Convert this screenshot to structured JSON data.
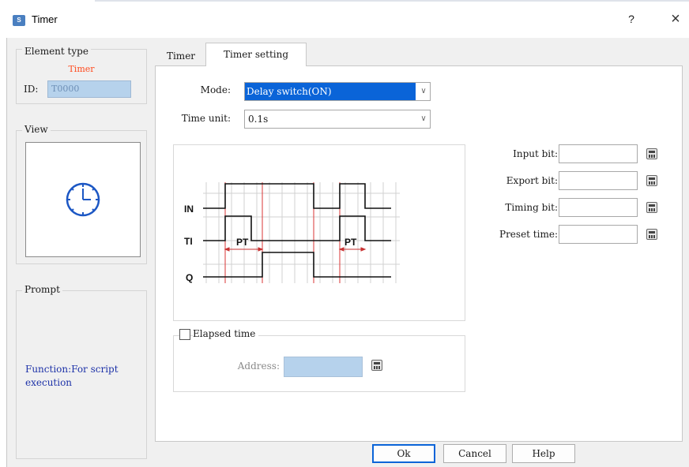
{
  "window": {
    "title": "Timer",
    "icon_text": "S",
    "help_symbol": "?",
    "close_symbol": "×"
  },
  "element_type": {
    "title": "Element type",
    "value": "Timer",
    "id_label": "ID:",
    "id_value": "T0000"
  },
  "view": {
    "title": "View",
    "icon": "clock-icon"
  },
  "prompt": {
    "title": "Prompt",
    "text": "Function:For script execution"
  },
  "tabs": [
    {
      "label": "Timer",
      "active": false
    },
    {
      "label": "Timer setting",
      "active": true
    }
  ],
  "form": {
    "mode_label": "Mode:",
    "mode_value": "Delay switch(ON)",
    "unit_label": "Time unit:",
    "unit_value": "0.1s"
  },
  "diagram": {
    "signals": [
      "IN",
      "TI",
      "Q"
    ],
    "pt_label": "PT"
  },
  "elapsed": {
    "label": "Elapsed time",
    "checked": false,
    "address_label": "Address:",
    "address_value": ""
  },
  "right_fields": [
    {
      "label": "Input bit:",
      "value": ""
    },
    {
      "label": "Export bit:",
      "value": ""
    },
    {
      "label": "Timing bit:",
      "value": ""
    },
    {
      "label": "Preset time:",
      "value": ""
    }
  ],
  "buttons": {
    "ok": "Ok",
    "cancel": "Cancel",
    "help": "Help"
  },
  "colors": {
    "selection": "#0a64d8",
    "id_field": "#b6d2ec",
    "prompt_text": "#1d32a8",
    "element_value": "#ff4b1f"
  }
}
